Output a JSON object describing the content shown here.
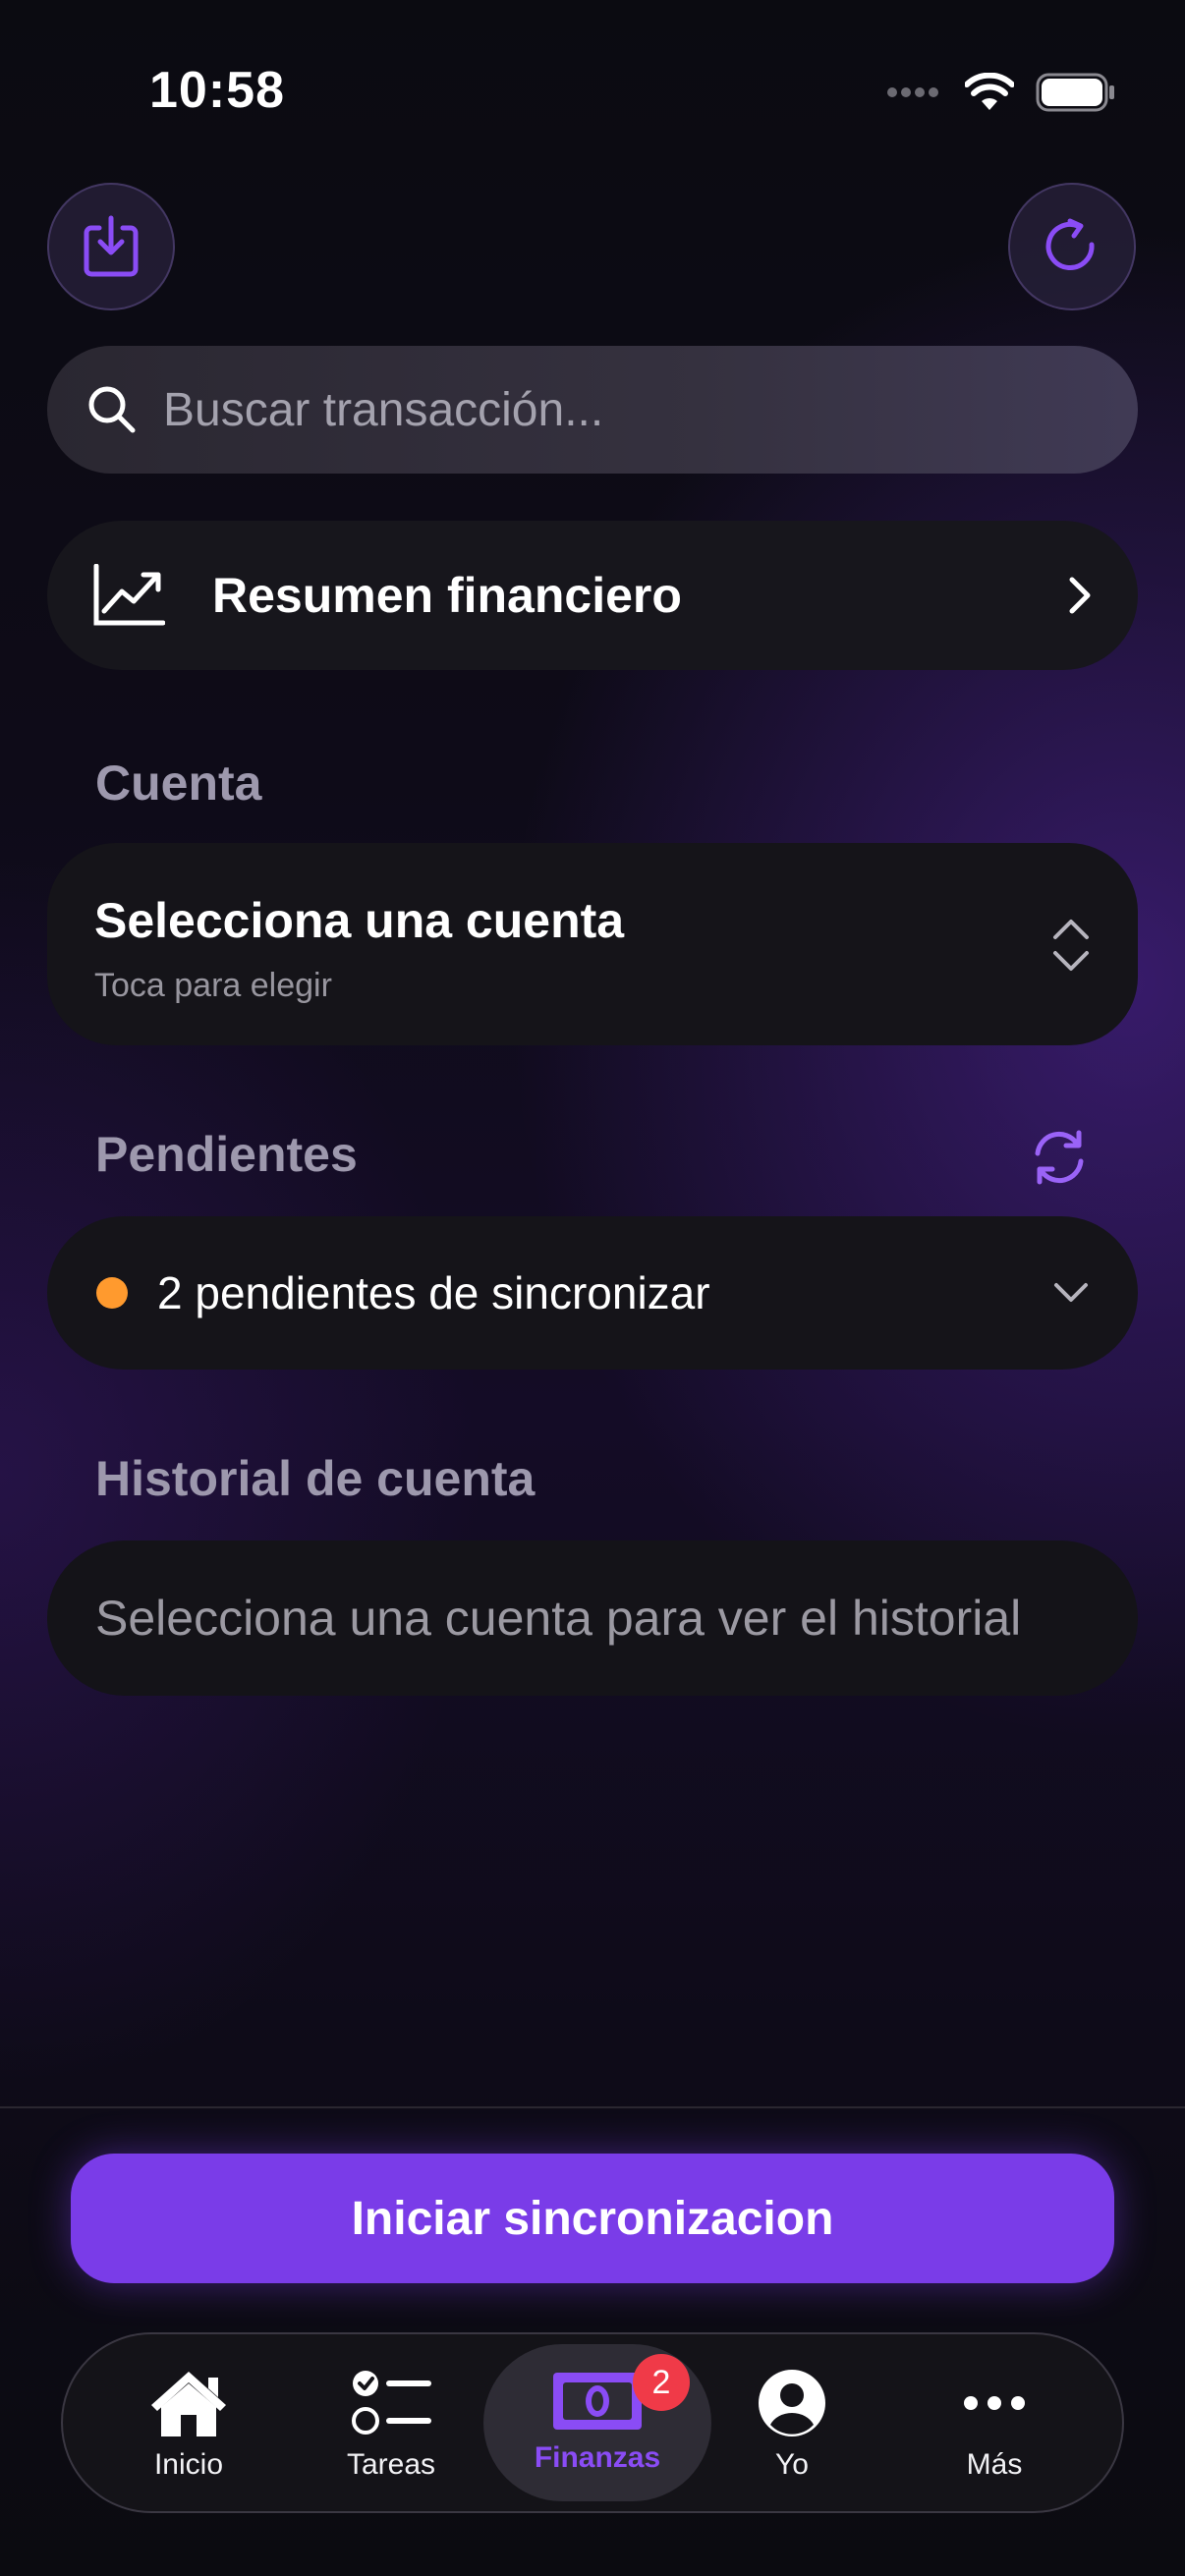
{
  "status_bar": {
    "time": "10:58"
  },
  "search": {
    "placeholder": "Buscar transacción..."
  },
  "summary": {
    "label": "Resumen financiero"
  },
  "account_section": {
    "title": "Cuenta",
    "card_title": "Selecciona una cuenta",
    "card_subtitle": "Toca para elegir"
  },
  "pending_section": {
    "title": "Pendientes",
    "status_text": "2 pendientes de sincronizar",
    "status_color": "#ff9a2e"
  },
  "history_section": {
    "title": "Historial de cuenta",
    "empty_text": "Selecciona una cuenta para ver el historial"
  },
  "sync_button": {
    "label": "Iniciar sincronizacion"
  },
  "tabbar": {
    "tabs": [
      {
        "label": "Inicio",
        "icon": "house-icon"
      },
      {
        "label": "Tareas",
        "icon": "checklist-icon"
      },
      {
        "label": "Finanzas",
        "icon": "banknote-icon",
        "active": true,
        "badge": "2"
      },
      {
        "label": "Yo",
        "icon": "person-icon"
      },
      {
        "label": "Más",
        "icon": "ellipsis-icon"
      }
    ]
  },
  "colors": {
    "accent": "#7a3ce8",
    "badge": "#f03a48"
  }
}
